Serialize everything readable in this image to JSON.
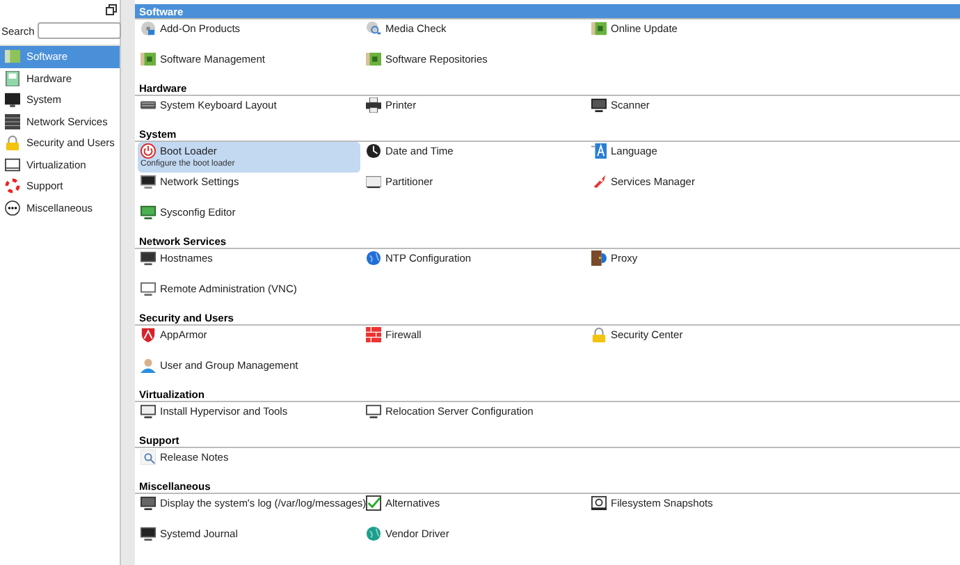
{
  "sidebar": {
    "search": {
      "label": "Search"
    },
    "items": [
      {
        "label": "Software",
        "selected": true
      },
      {
        "label": "Hardware",
        "selected": false
      },
      {
        "label": "System",
        "selected": false
      },
      {
        "label": "Network Services",
        "selected": false
      },
      {
        "label": "Security and Users",
        "selected": false
      },
      {
        "label": "Virtualization",
        "selected": false
      },
      {
        "label": "Support",
        "selected": false
      },
      {
        "label": "Miscellaneous",
        "selected": false
      }
    ]
  },
  "sections": [
    {
      "title": "Software",
      "selected": true,
      "items": [
        {
          "label": "Add-On Products",
          "selected": false
        },
        {
          "label": "Media Check",
          "selected": false
        },
        {
          "label": "Online Update",
          "selected": false
        },
        {
          "label": "Software Management",
          "selected": false
        },
        {
          "label": "Software Repositories",
          "selected": false
        }
      ]
    },
    {
      "title": "Hardware",
      "selected": false,
      "items": [
        {
          "label": "System Keyboard Layout",
          "selected": false
        },
        {
          "label": "Printer",
          "selected": false
        },
        {
          "label": "Scanner",
          "selected": false
        }
      ]
    },
    {
      "title": "System",
      "selected": false,
      "items": [
        {
          "label": "Boot Loader",
          "selected": true,
          "description": "Configure the boot loader"
        },
        {
          "label": "Date and Time",
          "selected": false
        },
        {
          "label": "Language",
          "selected": false
        },
        {
          "label": "Network Settings",
          "selected": false
        },
        {
          "label": "Partitioner",
          "selected": false
        },
        {
          "label": "Services Manager",
          "selected": false
        },
        {
          "label": "Sysconfig Editor",
          "selected": false
        }
      ]
    },
    {
      "title": "Network Services",
      "selected": false,
      "items": [
        {
          "label": "Hostnames",
          "selected": false
        },
        {
          "label": "NTP Configuration",
          "selected": false
        },
        {
          "label": "Proxy",
          "selected": false
        },
        {
          "label": "Remote Administration (VNC)",
          "selected": false
        }
      ]
    },
    {
      "title": "Security and Users",
      "selected": false,
      "items": [
        {
          "label": "AppArmor",
          "selected": false
        },
        {
          "label": "Firewall",
          "selected": false
        },
        {
          "label": "Security Center",
          "selected": false
        },
        {
          "label": "User and Group Management",
          "selected": false
        }
      ]
    },
    {
      "title": "Virtualization",
      "selected": false,
      "items": [
        {
          "label": "Install Hypervisor and Tools",
          "selected": false
        },
        {
          "label": "Relocation Server Configuration",
          "selected": false
        }
      ]
    },
    {
      "title": "Support",
      "selected": false,
      "items": [
        {
          "label": "Release Notes",
          "selected": false
        }
      ]
    },
    {
      "title": "Miscellaneous",
      "selected": false,
      "items": [
        {
          "label": "Display the system's log (/var/log/messages)",
          "selected": false
        },
        {
          "label": "Alternatives",
          "selected": false
        },
        {
          "label": "Filesystem Snapshots",
          "selected": false
        },
        {
          "label": "Systemd Journal",
          "selected": false
        },
        {
          "label": "Vendor Driver",
          "selected": false
        }
      ]
    }
  ]
}
